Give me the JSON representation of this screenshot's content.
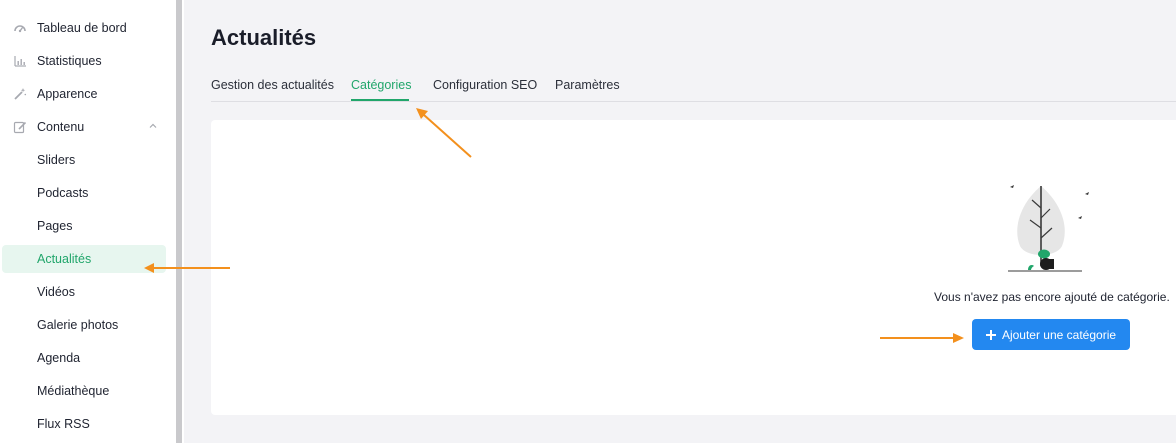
{
  "sidebar": {
    "items": [
      {
        "label": "Tableau de bord",
        "icon": "dashboard-icon"
      },
      {
        "label": "Statistiques",
        "icon": "bar-chart-icon"
      },
      {
        "label": "Apparence",
        "icon": "magic-wand-icon"
      },
      {
        "label": "Contenu",
        "icon": "edit-icon",
        "expanded": true
      },
      {
        "label": "Sliders"
      },
      {
        "label": "Podcasts"
      },
      {
        "label": "Pages"
      },
      {
        "label": "Actualités",
        "active": true
      },
      {
        "label": "Vidéos"
      },
      {
        "label": "Galerie photos"
      },
      {
        "label": "Agenda"
      },
      {
        "label": "Médiathèque"
      },
      {
        "label": "Flux RSS"
      }
    ]
  },
  "main": {
    "title": "Actualités",
    "tabs": [
      {
        "label": "Gestion des actualités"
      },
      {
        "label": "Catégories",
        "active": true
      },
      {
        "label": "Configuration SEO"
      },
      {
        "label": "Paramètres"
      }
    ],
    "empty_state": {
      "message": "Vous n'avez pas encore ajouté de catégorie.",
      "button_label": "Ajouter une catégorie",
      "illustration": "plant-empty-state-illustration"
    }
  },
  "colors": {
    "accent_green": "#21a66b",
    "active_bg": "#e7f6ef",
    "button_blue": "#2388f0",
    "annotation_arrow": "#f3901d",
    "page_bg": "#f3f3f6"
  }
}
